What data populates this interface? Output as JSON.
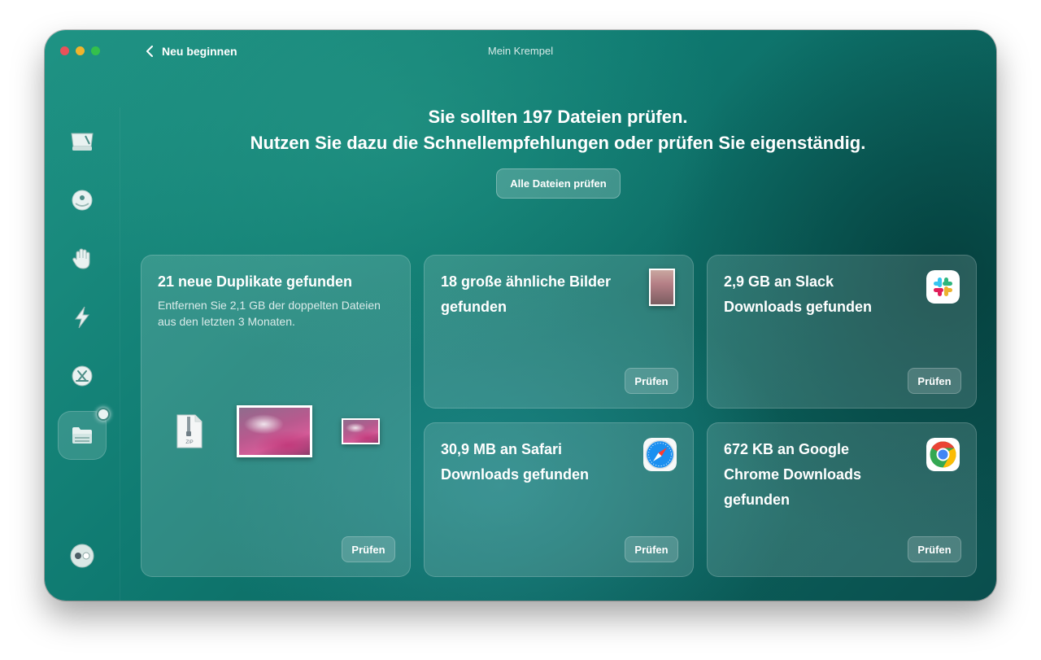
{
  "window": {
    "title": "Mein Krempel",
    "back_label": "Neu beginnen"
  },
  "sidebar": {
    "items": [
      {
        "icon": "disk-icon",
        "active": false
      },
      {
        "icon": "shield-icon",
        "active": false
      },
      {
        "icon": "hand-icon",
        "active": false
      },
      {
        "icon": "lightning-icon",
        "active": false
      },
      {
        "icon": "app-store-icon",
        "active": false
      },
      {
        "icon": "folder-icon",
        "active": true
      }
    ],
    "bottom_icon": "assistant-icon"
  },
  "header": {
    "line1": "Sie sollten 197 Dateien prüfen.",
    "line2": "Nutzen Sie dazu die Schnellempfehlungen oder prüfen Sie eigenständig.",
    "all_button": "Alle Dateien prüfen"
  },
  "cards": [
    {
      "title": "21 neue Duplikate gefunden",
      "subtitle": "Entfernen Sie 2,1 GB der doppelten Dateien aus den letzten 3 Monaten.",
      "button": "Prüfen",
      "zip_label": "ZIP"
    },
    {
      "title_line1": "18 große ähnliche Bilder",
      "title_line2": "gefunden",
      "button": "Prüfen",
      "icon": "photo-thumbnail-icon"
    },
    {
      "title_line1": "2,9 GB an Slack",
      "title_line2": "Downloads gefunden",
      "button": "Prüfen",
      "icon": "slack-icon"
    },
    {
      "title_line1": "30,9 MB an Safari",
      "title_line2": "Downloads gefunden",
      "button": "Prüfen",
      "icon": "safari-icon"
    },
    {
      "title_line1": "672 KB an Google",
      "title_line2": "Chrome Downloads",
      "title_line3": "gefunden",
      "button": "Prüfen",
      "icon": "chrome-icon"
    }
  ]
}
